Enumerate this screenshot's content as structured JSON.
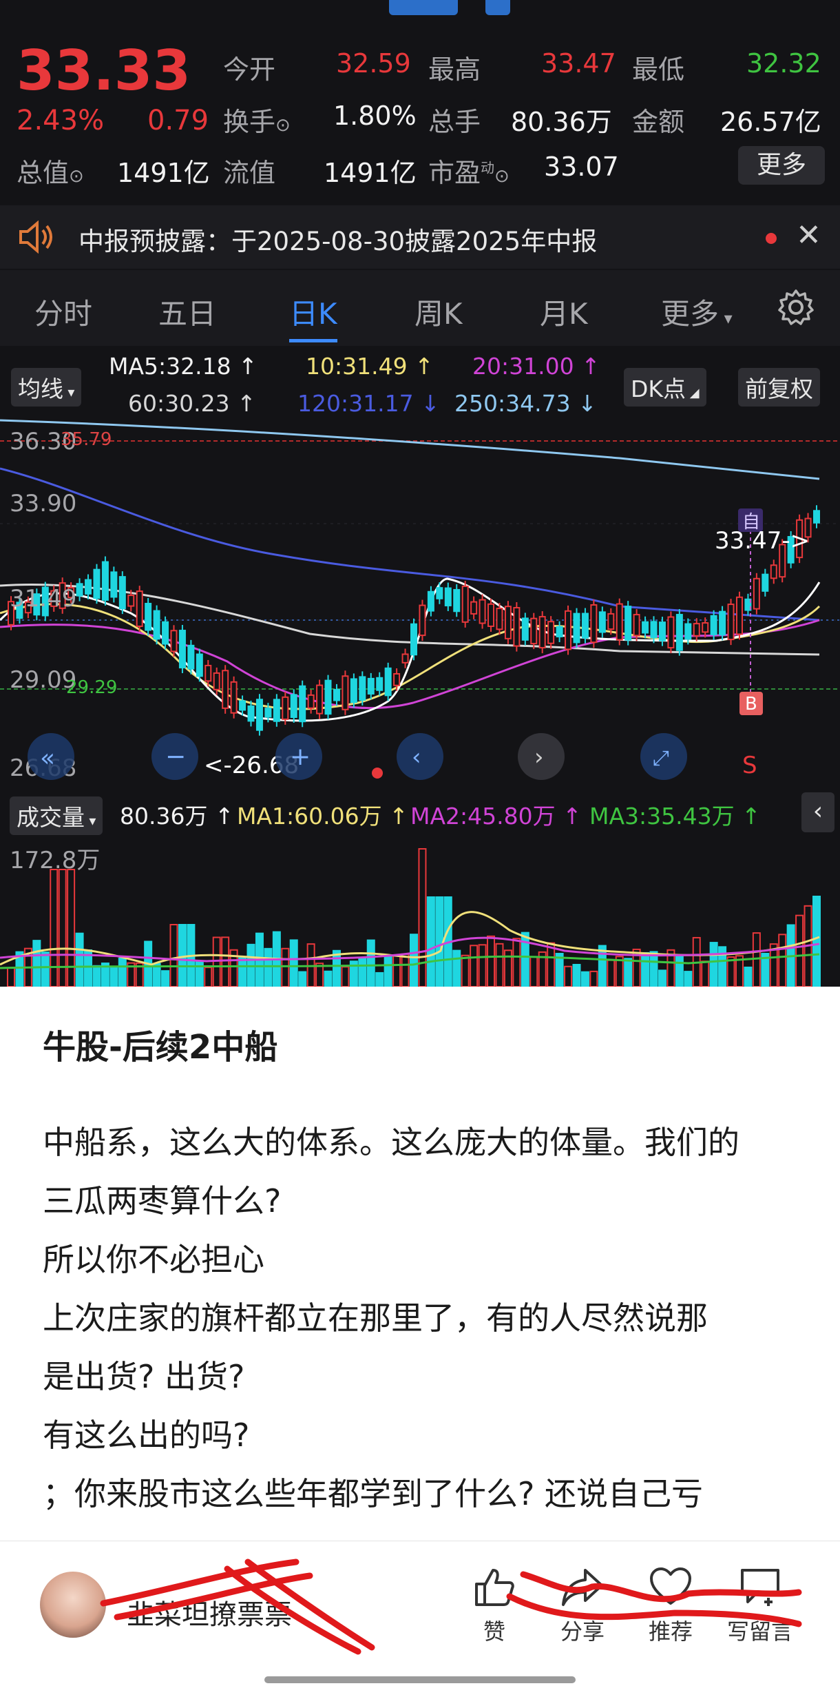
{
  "quote": {
    "price": "33.33",
    "change_pct": "2.43%",
    "change": "0.79",
    "open_label": "今开",
    "open": "32.59",
    "high_label": "最高",
    "high": "33.47",
    "low_label": "最低",
    "low": "32.32",
    "turnover_label": "换手",
    "turnover": "1.80%",
    "volume_label": "总手",
    "volume": "80.36万",
    "amount_label": "金额",
    "amount": "26.57亿",
    "mcap_label": "总值",
    "mcap": "1491亿",
    "float_label": "流值",
    "float": "1491亿",
    "pe_label": "市盈",
    "pe_sup": "动",
    "pe": "33.07",
    "more": "更多"
  },
  "notice": {
    "text": "中报预披露：于2025-08-30披露2025年中报"
  },
  "tabs": [
    "分时",
    "五日",
    "日K",
    "周K",
    "月K",
    "更多"
  ],
  "active_tab": 2,
  "ma_bar": {
    "toggle": "均线",
    "ma5": "MA5:32.18 ↑",
    "ma10": "10:31.49 ↑",
    "ma20": "20:31.00 ↑",
    "ma60": "60:30.23 ↑",
    "ma120": "120:31.17 ↓",
    "ma250": "250:34.73 ↓",
    "dk": "DK点",
    "fq": "前复权"
  },
  "kline": {
    "y_labels": [
      "36.30",
      "33.90",
      "31.49",
      "29.09",
      "26.68"
    ],
    "upper_price_label": "35.79",
    "cost_label": "29.29",
    "high_marker": "33.47->",
    "low_marker": "<-26.68",
    "mark_zi": "自",
    "mark_b": "B",
    "mark_s": "S"
  },
  "volume_bar": {
    "toggle": "成交量",
    "vol": "80.36万 ↑",
    "ma1": "MA1:60.06万 ↑",
    "ma2": "MA2:45.80万 ↑",
    "ma3": "MA3:35.43万 ↑",
    "max_label": "172.8万"
  },
  "colors": {
    "up": "#e8383b",
    "down": "#1fd6e0",
    "accent": "#3d8bff",
    "bg": "#131316"
  },
  "article": {
    "title": "牛股-后续2中船",
    "lines": [
      "中船系，这么大的体系。这么庞大的体量。我们的",
      "三瓜两枣算什么?",
      "所以你不必担心",
      "上次庄家的旗杆都立在那里了，有的人尽然说那",
      "是出货? 出货?",
      "有这么出的吗?",
      "；你来股市这么些年都学到了什么? 还说自己亏"
    ]
  },
  "author": {
    "name": "韭菜坦撩票票"
  },
  "actions": [
    {
      "icon": "thumbs-up-icon",
      "label": "赞"
    },
    {
      "icon": "share-icon",
      "label": "分享"
    },
    {
      "icon": "heart-icon",
      "label": "推荐"
    },
    {
      "icon": "comment-icon",
      "label": "写留言"
    }
  ]
}
